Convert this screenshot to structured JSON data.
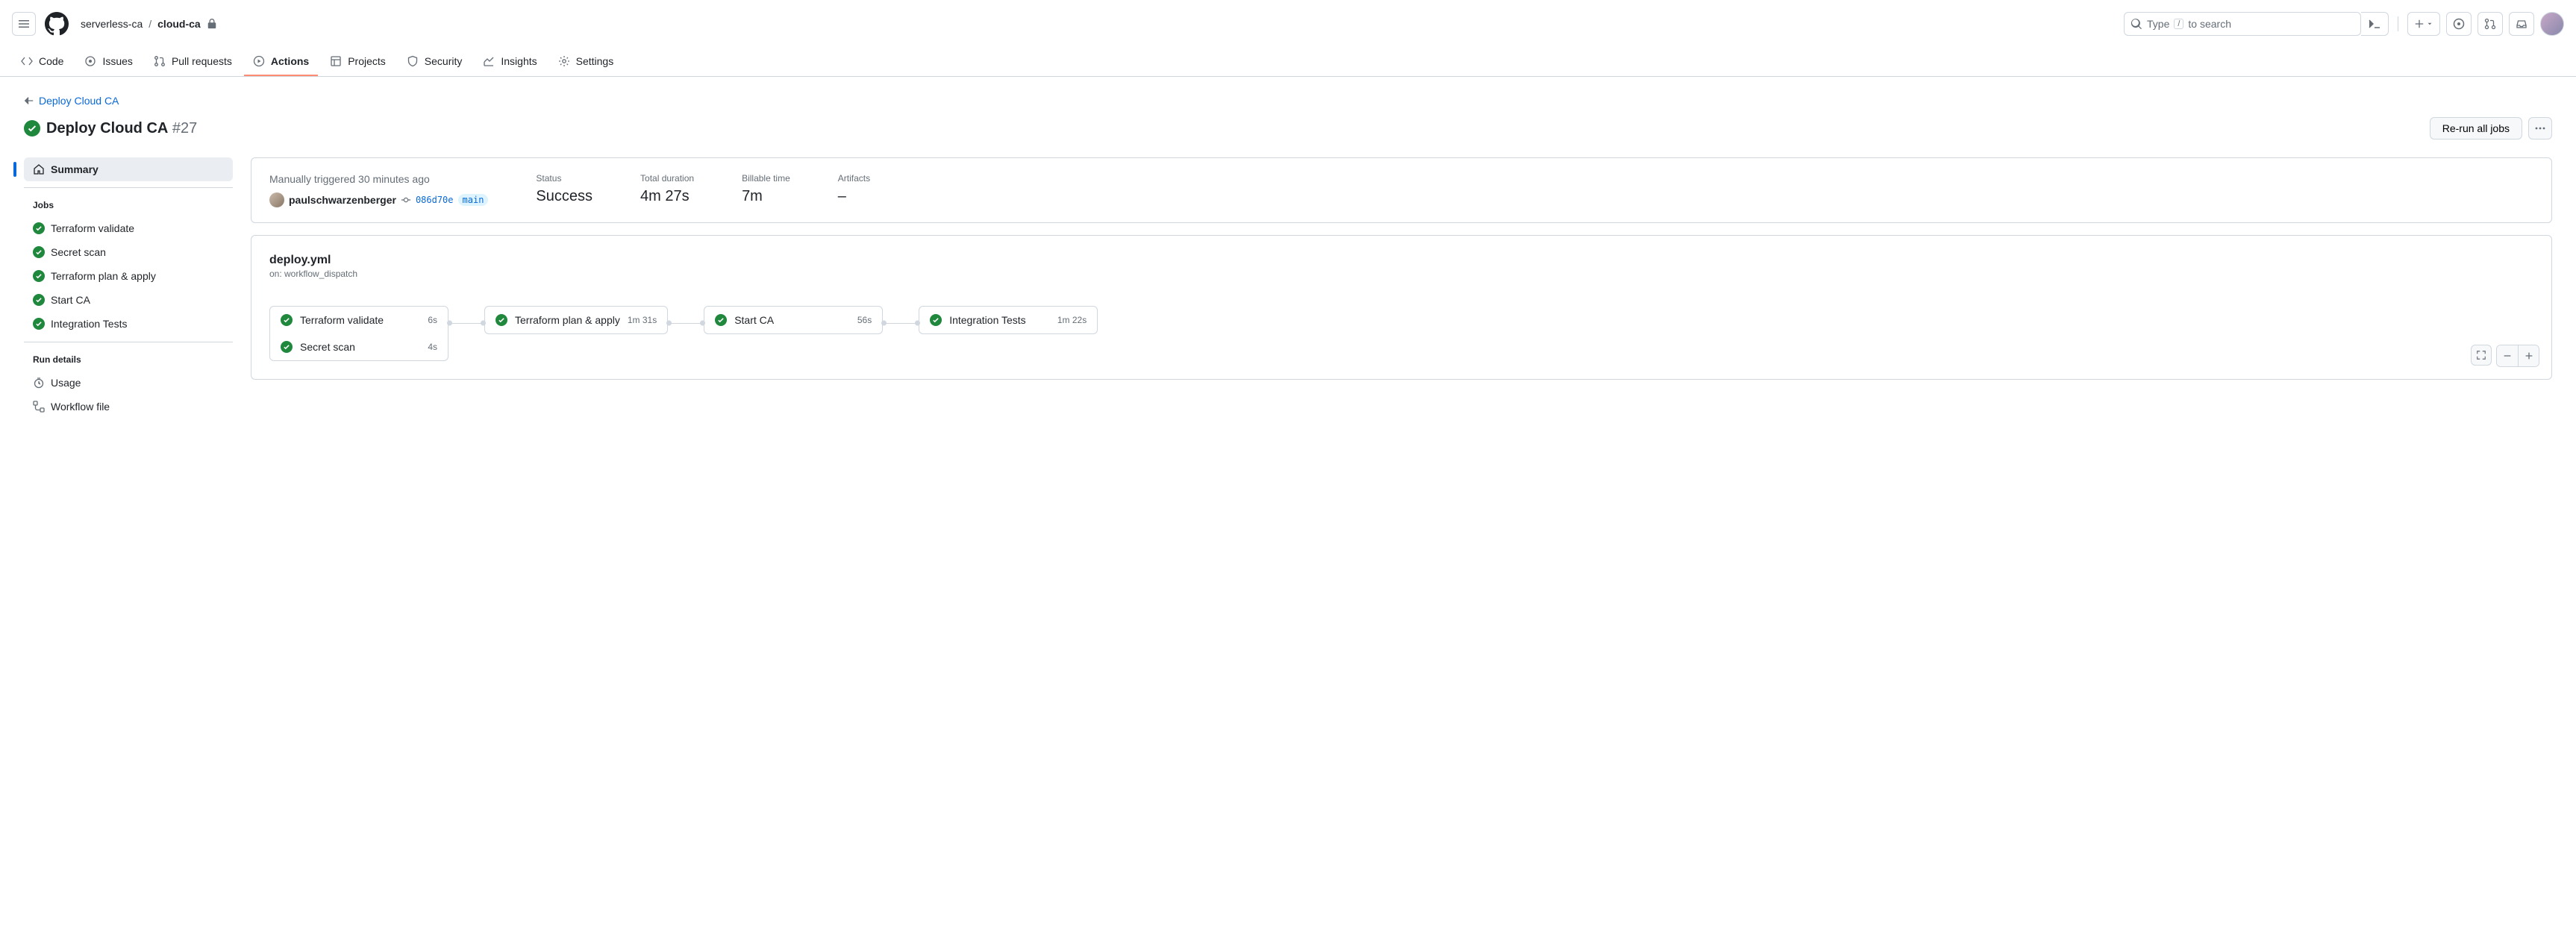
{
  "header": {
    "owner": "serverless-ca",
    "repo": "cloud-ca",
    "search_placeholder": "Type",
    "search_hint_key": "/",
    "search_hint_rest": "to search"
  },
  "nav": {
    "code": "Code",
    "issues": "Issues",
    "pulls": "Pull requests",
    "actions": "Actions",
    "projects": "Projects",
    "security": "Security",
    "insights": "Insights",
    "settings": "Settings"
  },
  "back_link": "Deploy Cloud CA",
  "run": {
    "name": "Deploy Cloud CA",
    "number": "#27",
    "rerun_button": "Re-run all jobs"
  },
  "sidebar": {
    "summary": "Summary",
    "jobs_heading": "Jobs",
    "jobs": [
      {
        "name": "Terraform validate"
      },
      {
        "name": "Secret scan"
      },
      {
        "name": "Terraform plan & apply"
      },
      {
        "name": "Start CA"
      },
      {
        "name": "Integration Tests"
      }
    ],
    "run_details_heading": "Run details",
    "usage": "Usage",
    "workflow_file": "Workflow file"
  },
  "summary": {
    "trigger_text": "Manually triggered 30 minutes ago",
    "user": "paulschwarzenberger",
    "commit": "086d70e",
    "branch": "main",
    "status_label": "Status",
    "status_value": "Success",
    "duration_label": "Total duration",
    "duration_value": "4m 27s",
    "billable_label": "Billable time",
    "billable_value": "7m",
    "artifacts_label": "Artifacts",
    "artifacts_value": "–"
  },
  "workflow": {
    "file": "deploy.yml",
    "on": "on: workflow_dispatch",
    "stage1": [
      {
        "name": "Terraform validate",
        "time": "6s"
      },
      {
        "name": "Secret scan",
        "time": "4s"
      }
    ],
    "stage2": {
      "name": "Terraform plan & apply",
      "time": "1m 31s"
    },
    "stage3": {
      "name": "Start CA",
      "time": "56s"
    },
    "stage4": {
      "name": "Integration Tests",
      "time": "1m 22s"
    }
  }
}
